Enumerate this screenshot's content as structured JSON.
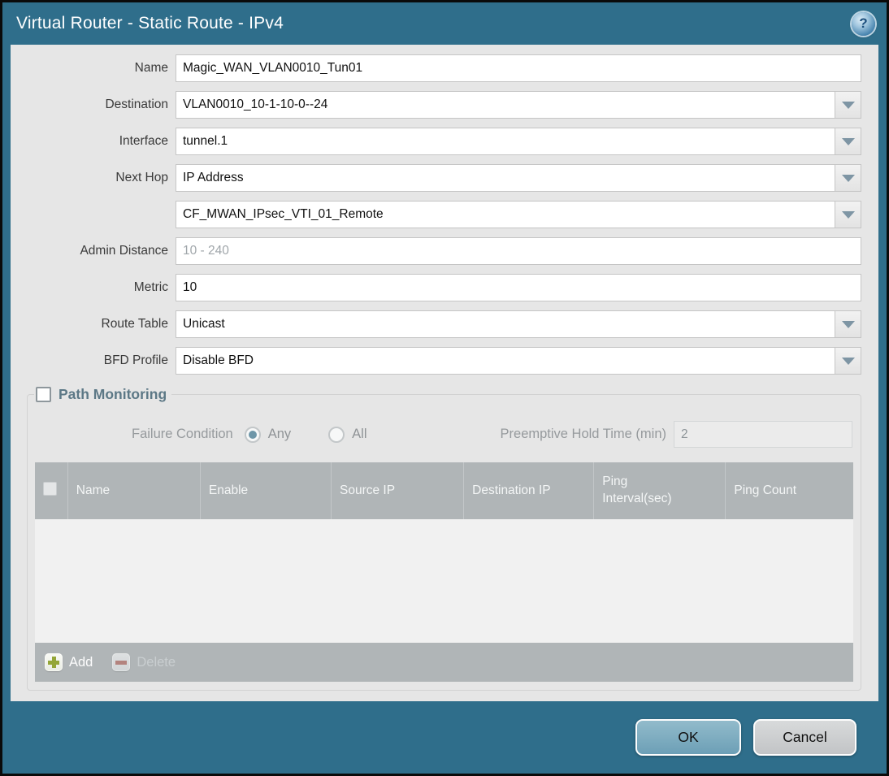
{
  "window": {
    "title": "Virtual Router - Static Route - IPv4",
    "help_glyph": "?"
  },
  "colors": {
    "accent_teal": "#2F6E8B",
    "content_bg": "#E6E6E6",
    "table_header_bg": "#B0B5B7",
    "ok_button_fill": "#7FADC0",
    "cancel_button_fill": "#C9CBCD",
    "add_icon_green": "#94A637",
    "delete_icon_red": "#B5736B",
    "radio_selected_dot": "#6E96A8",
    "section_title": "#5C7886"
  },
  "form": {
    "rows": [
      {
        "label": "Name",
        "value": "Magic_WAN_VLAN0010_Tun01"
      },
      {
        "label": "Destination",
        "value": "VLAN0010_10-1-10-0--24"
      },
      {
        "label": "Interface",
        "value": "tunnel.1"
      },
      {
        "label": "Next Hop",
        "value": "IP Address"
      },
      {
        "label": "",
        "value": "CF_MWAN_IPsec_VTI_01_Remote"
      },
      {
        "label": "Admin Distance",
        "value": "",
        "placeholder": "10 - 240"
      },
      {
        "label": "Metric",
        "value": "10"
      },
      {
        "label": "Route Table",
        "value": "Unicast"
      },
      {
        "label": "BFD Profile",
        "value": "Disable BFD"
      }
    ]
  },
  "path_monitoring": {
    "title": "Path Monitoring",
    "enabled": false,
    "failure_condition_label": "Failure Condition",
    "radio_any_label": "Any",
    "radio_all_label": "All",
    "selected_failure_condition": "Any",
    "hold_time_label": "Preemptive Hold Time (min)",
    "hold_time_value": "2",
    "table": {
      "columns": [
        "Name",
        "Enable",
        "Source IP",
        "Destination IP",
        "Ping Interval(sec)",
        "Ping Count"
      ],
      "rows": []
    },
    "toolbar": {
      "add_label": "Add",
      "delete_label": "Delete"
    }
  },
  "footer": {
    "ok_label": "OK",
    "cancel_label": "Cancel"
  }
}
